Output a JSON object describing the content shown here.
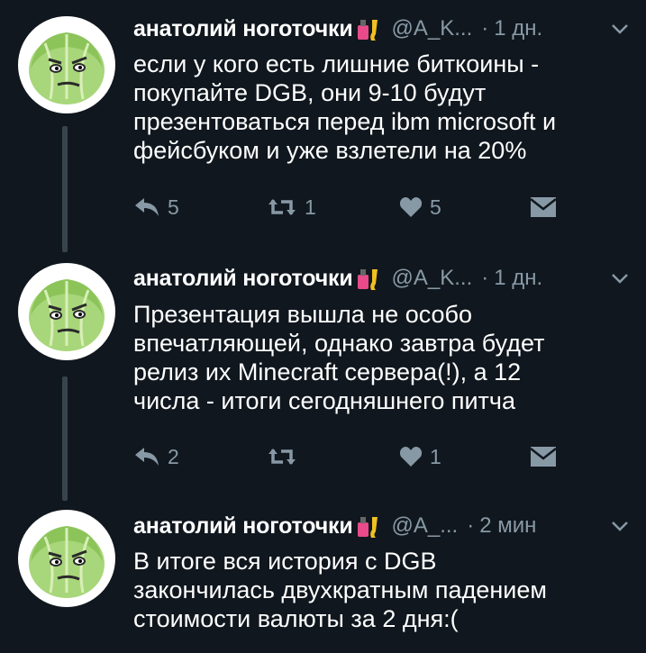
{
  "tweets": [
    {
      "name": "анатолий ноготочки",
      "handle": "@A_K...",
      "time": "1 дн.",
      "lines": [
        "если у кого есть лишние биткоины -",
        "покупайте DGB, они 9-10 будут",
        "презентоваться перед ibm microsoft и",
        "фейсбуком и уже взлетели на 20%"
      ],
      "replies": "5",
      "retweets": "1",
      "likes": "5"
    },
    {
      "name": "анатолий ноготочки",
      "handle": "@A_K...",
      "time": "1 дн.",
      "lines": [
        "Презентация вышла не особо",
        "впечатляющей, однако завтра будет",
        "релиз их Minecraft сервера(!), а 12",
        "числа - итоги сегодняшнего питча"
      ],
      "replies": "2",
      "retweets": "",
      "likes": "1"
    },
    {
      "name": "анатолий ноготочки",
      "handle": "@A_...",
      "time": "2 мин",
      "lines": [
        "В итоге вся история с DGB",
        "закончилась двухкратным падением",
        "стоимости валюты за 2 дня:("
      ]
    }
  ],
  "separator": "·",
  "icons": {
    "avatar": "cabbage-avatar",
    "name_emoji": "nail-polish-emoji",
    "caret": "chevron-down-icon",
    "reply": "reply-icon",
    "retweet": "retweet-icon",
    "like": "heart-icon",
    "dm": "direct-message-icon"
  },
  "colors": {
    "background": "#10171e",
    "text": "#ffffff",
    "secondary": "#8899a6",
    "thread_line": "#38444d"
  }
}
